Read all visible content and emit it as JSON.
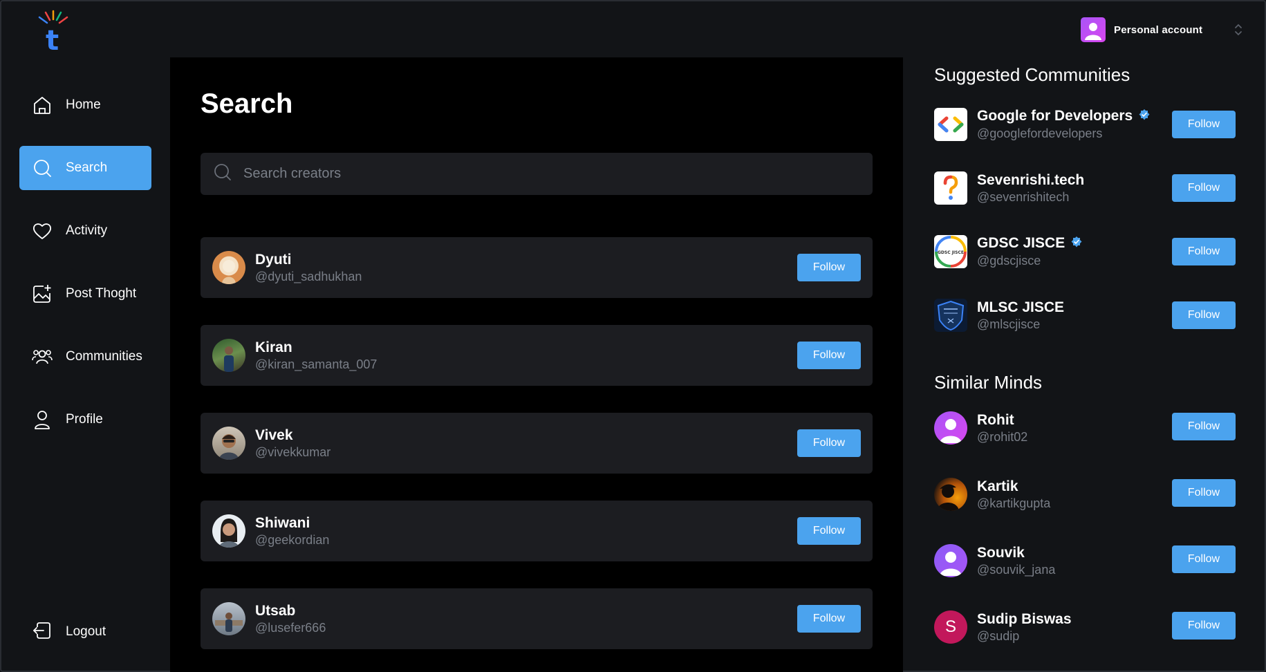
{
  "account": {
    "label": "Personal account",
    "icon": "user-icon"
  },
  "nav": {
    "items": [
      {
        "label": "Home",
        "icon": "home-icon"
      },
      {
        "label": "Search",
        "icon": "search-icon",
        "active": true
      },
      {
        "label": "Activity",
        "icon": "heart-icon"
      },
      {
        "label": "Post Thoght",
        "icon": "image-plus-icon"
      },
      {
        "label": "Communities",
        "icon": "users-icon"
      },
      {
        "label": "Profile",
        "icon": "user-icon"
      }
    ],
    "logout": "Logout"
  },
  "main": {
    "title": "Search",
    "search_placeholder": "Search creators",
    "creators": [
      {
        "name": "Dyuti",
        "handle": "@dyuti_sadhukhan",
        "follow": "Follow"
      },
      {
        "name": "Kiran",
        "handle": "@kiran_samanta_007",
        "follow": "Follow"
      },
      {
        "name": "Vivek",
        "handle": "@vivekkumar",
        "follow": "Follow"
      },
      {
        "name": "Shiwani",
        "handle": "@geekordian",
        "follow": "Follow"
      },
      {
        "name": "Utsab",
        "handle": "@lusefer666",
        "follow": "Follow"
      }
    ]
  },
  "right": {
    "communities_title": "Suggested Communities",
    "communities": [
      {
        "name": "Google for Developers",
        "handle": "@googlefordevelopers",
        "verified": true,
        "follow": "Follow"
      },
      {
        "name": "Sevenrishi.tech",
        "handle": "@sevenrishitech",
        "verified": false,
        "follow": "Follow"
      },
      {
        "name": "GDSC JISCE",
        "handle": "@gdscjisce",
        "verified": true,
        "follow": "Follow",
        "logo_text": "GDSC JISCE"
      },
      {
        "name": "MLSC JISCE",
        "handle": "@mlscjisce",
        "verified": false,
        "follow": "Follow"
      }
    ],
    "minds_title": "Similar Minds",
    "minds": [
      {
        "name": "Rohit",
        "handle": "@rohit02",
        "follow": "Follow"
      },
      {
        "name": "Kartik",
        "handle": "@kartikgupta",
        "follow": "Follow"
      },
      {
        "name": "Souvik",
        "handle": "@souvik_jana",
        "follow": "Follow"
      },
      {
        "name": "Sudip Biswas",
        "handle": "@sudip",
        "follow": "Follow",
        "initial": "S"
      }
    ]
  },
  "colors": {
    "accent": "#4ba3ee",
    "background": "#121417",
    "card": "#1c1d21",
    "muted": "#7a7f88"
  }
}
